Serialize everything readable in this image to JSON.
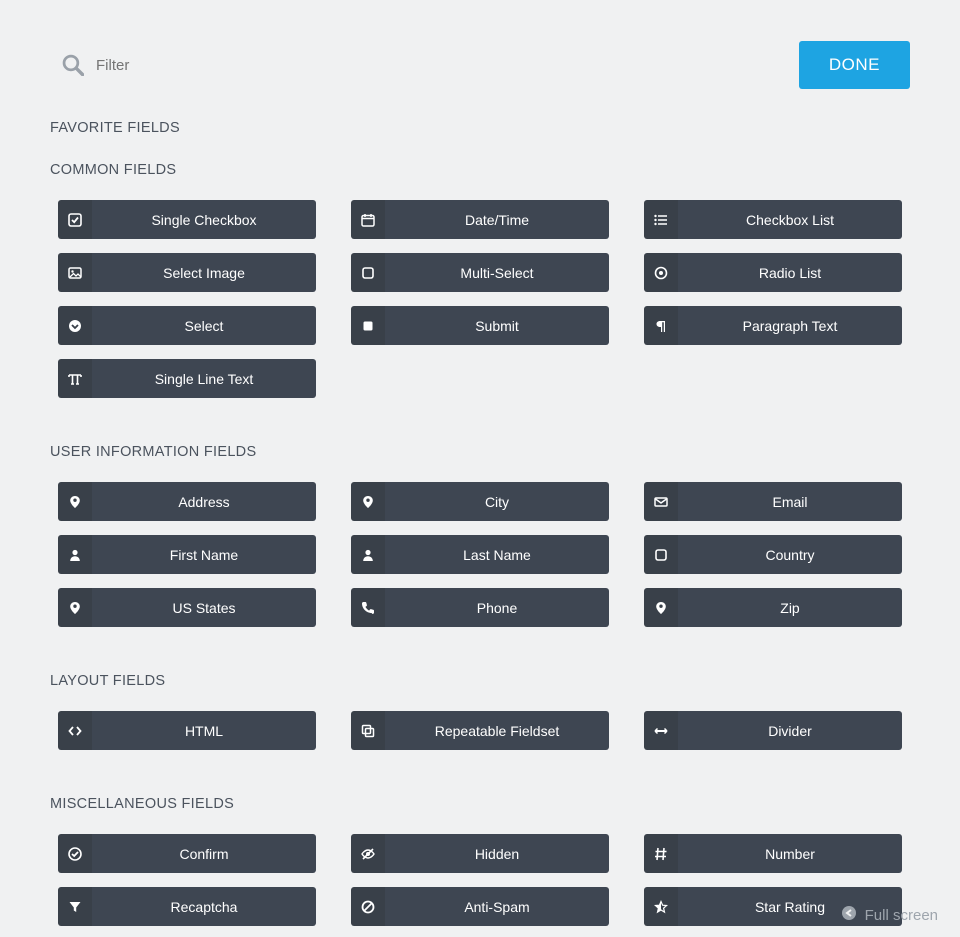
{
  "filter": {
    "placeholder": "Filter"
  },
  "done_label": "DONE",
  "full_screen_label": "Full screen",
  "sections": {
    "favorite": {
      "heading": "FAVORITE FIELDS",
      "items": []
    },
    "common": {
      "heading": "COMMON FIELDS",
      "items": [
        {
          "label": "Single Checkbox",
          "icon": "check-square-icon"
        },
        {
          "label": "Date/Time",
          "icon": "calendar-icon"
        },
        {
          "label": "Checkbox List",
          "icon": "list-icon"
        },
        {
          "label": "Select Image",
          "icon": "image-icon"
        },
        {
          "label": "Multi-Select",
          "icon": "square-icon"
        },
        {
          "label": "Radio List",
          "icon": "dot-circle-icon"
        },
        {
          "label": "Select",
          "icon": "chevron-down-icon"
        },
        {
          "label": "Submit",
          "icon": "square-filled-icon"
        },
        {
          "label": "Paragraph Text",
          "icon": "pilcrow-icon"
        },
        {
          "label": "Single Line Text",
          "icon": "text-icon"
        }
      ]
    },
    "user": {
      "heading": "USER INFORMATION FIELDS",
      "items": [
        {
          "label": "Address",
          "icon": "map-marker-icon"
        },
        {
          "label": "City",
          "icon": "map-marker-icon"
        },
        {
          "label": "Email",
          "icon": "envelope-icon"
        },
        {
          "label": "First Name",
          "icon": "user-icon"
        },
        {
          "label": "Last Name",
          "icon": "user-icon"
        },
        {
          "label": "Country",
          "icon": "square-icon"
        },
        {
          "label": "US States",
          "icon": "map-marker-icon"
        },
        {
          "label": "Phone",
          "icon": "phone-icon"
        },
        {
          "label": "Zip",
          "icon": "map-marker-icon"
        }
      ]
    },
    "layout": {
      "heading": "LAYOUT FIELDS",
      "items": [
        {
          "label": "HTML",
          "icon": "code-icon"
        },
        {
          "label": "Repeatable Fieldset",
          "icon": "copy-icon"
        },
        {
          "label": "Divider",
          "icon": "hr-icon"
        }
      ]
    },
    "misc": {
      "heading": "MISCELLANEOUS FIELDS",
      "items": [
        {
          "label": "Confirm",
          "icon": "check-circle-icon"
        },
        {
          "label": "Hidden",
          "icon": "eye-slash-icon"
        },
        {
          "label": "Number",
          "icon": "hash-icon"
        },
        {
          "label": "Recaptcha",
          "icon": "filter-icon"
        },
        {
          "label": "Anti-Spam",
          "icon": "ban-icon"
        },
        {
          "label": "Star Rating",
          "icon": "star-half-icon"
        }
      ]
    }
  }
}
